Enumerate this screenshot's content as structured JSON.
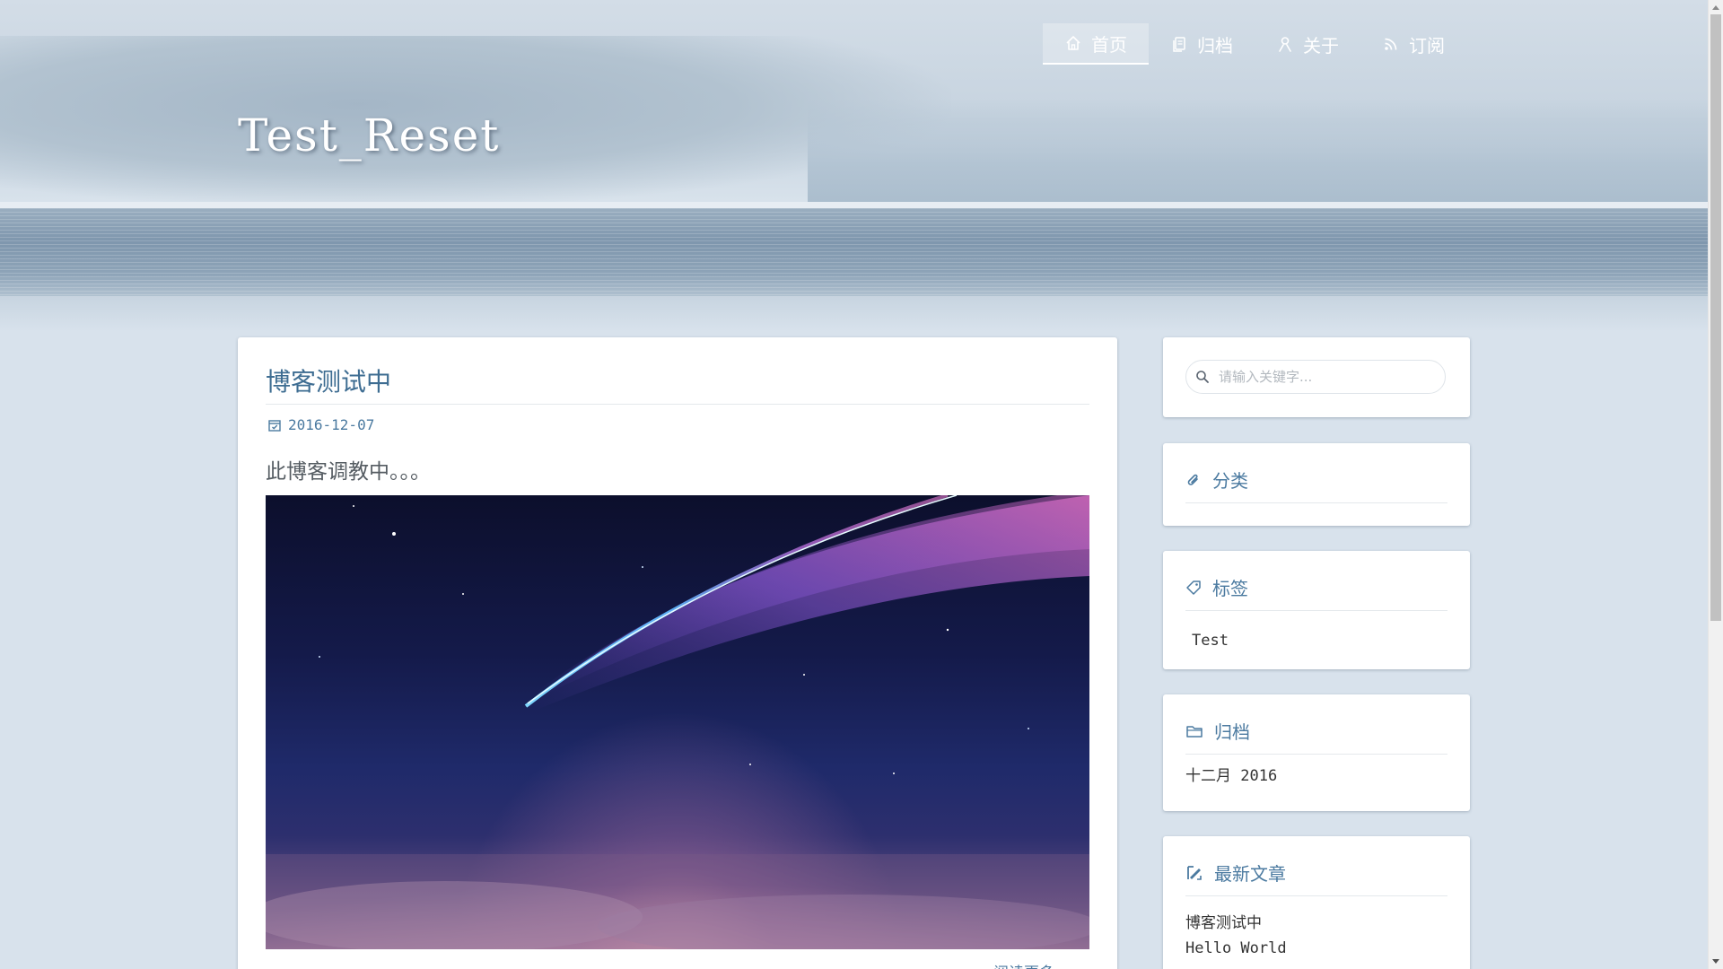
{
  "site": {
    "title": "Test_Reset"
  },
  "nav": {
    "items": [
      {
        "label": "首页",
        "icon": "home-icon",
        "active": true
      },
      {
        "label": "归档",
        "icon": "archive-icon",
        "active": false
      },
      {
        "label": "关于",
        "icon": "user-icon",
        "active": false
      },
      {
        "label": "订阅",
        "icon": "rss-icon",
        "active": false
      }
    ]
  },
  "post": {
    "title": "博客测试中",
    "date": "2016-12-07",
    "excerpt": "此博客调教中。。。",
    "image": "comet-night-sky",
    "read_more": "阅读更多 »"
  },
  "sidebar": {
    "search": {
      "placeholder": "请输入关键字..."
    },
    "categories": {
      "title": "分类",
      "icon": "paperclip-icon"
    },
    "tags": {
      "title": "标签",
      "icon": "tag-icon",
      "items": [
        "Test"
      ]
    },
    "archives": {
      "title": "归档",
      "icon": "folder-icon",
      "items": [
        "十二月 2016"
      ]
    },
    "recent": {
      "title": "最新文章",
      "icon": "edit-icon",
      "items": [
        "博客测试中",
        "Hello World"
      ]
    }
  },
  "colors": {
    "accent": "#4b7aa0",
    "title_link": "#3e6d92",
    "background": "#d8e2ec"
  }
}
